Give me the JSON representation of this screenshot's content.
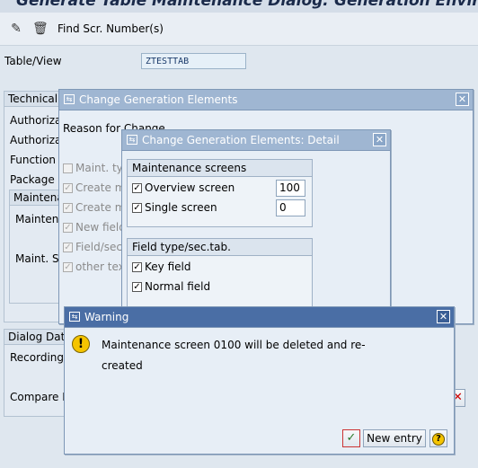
{
  "window": {
    "title": "Generate Table Maintenance Dialog: Generation Environment"
  },
  "toolbar": {
    "edit_icon": "pencil-icon",
    "delete_icon": "trash-icon",
    "find_label": "Find Scr. Number(s)"
  },
  "main": {
    "table_view_label": "Table/View",
    "table_view_value": "ZTESTTAB",
    "technical_group": "Technical",
    "authoriz_1": "Authorizat",
    "authoriz_2": "Authorizat",
    "function_g": "Function g",
    "package": "Package",
    "maintena_group": "Maintena",
    "maintena_label": "Maintena",
    "maint_sc": "Maint. Sc",
    "dialog_data_group": "Dialog Dat",
    "recording": "Recording",
    "compare": "Compare I"
  },
  "dialog_elements": {
    "title": "Change Generation Elements",
    "reason_label": "Reason for Change",
    "items": [
      {
        "label": "Maint. typ",
        "checked": false
      },
      {
        "label": "Create m",
        "checked": true
      },
      {
        "label": "Create m",
        "checked": true
      },
      {
        "label": "New field",
        "checked": true
      },
      {
        "label": "Field/sec.",
        "checked": true
      },
      {
        "label": "other tex",
        "checked": true
      }
    ]
  },
  "dialog_detail": {
    "title": "Change Generation Elements: Detail",
    "maint_screens": {
      "heading": "Maintenance screens",
      "overview_label": "Overview screen",
      "overview_value": "100",
      "single_label": "Single screen",
      "single_value": "0"
    },
    "field_type": {
      "heading": "Field type/sec.tab.",
      "key_field_label": "Key field",
      "normal_field_label": "Normal field"
    }
  },
  "dialog_warning": {
    "title": "Warning",
    "message_line1": "Maintenance screen 0100 will be deleted and re-",
    "message_line2": "created",
    "confirm_icon": "checkmark-icon",
    "new_entry_label": "New entry",
    "help_icon": "help-icon",
    "warning_icon": "exclamation-icon"
  },
  "colors": {
    "dialog_title_bg": "#9fb6d2",
    "warning_title_bg": "#4a6ea5",
    "warning_icon": "#f5c400",
    "field_text": "#1a3a6a"
  }
}
